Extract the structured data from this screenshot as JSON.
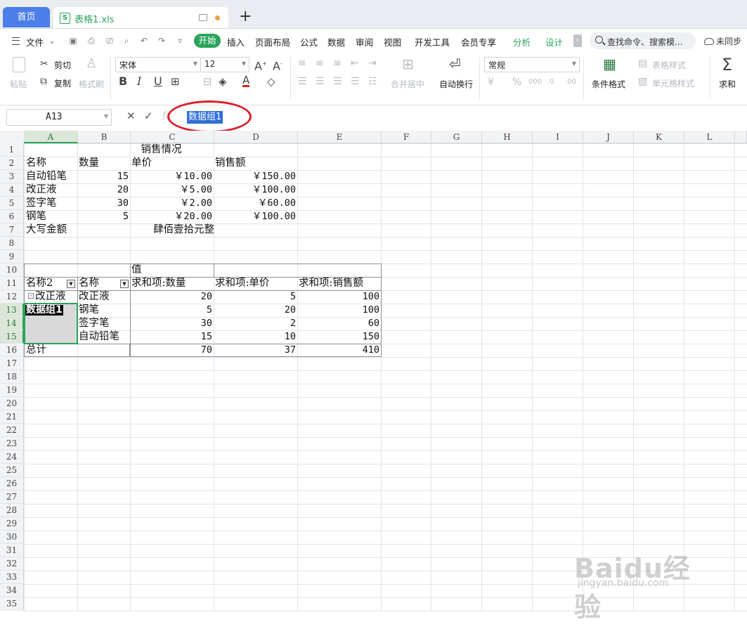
{
  "tabs": {
    "home": "首页",
    "file": "表格1.xls",
    "add": "+"
  },
  "menu": {
    "file": "文件",
    "items": [
      "开始",
      "插入",
      "页面布局",
      "公式",
      "数据",
      "审阅",
      "视图",
      "开发工具",
      "会员专享",
      "分析",
      "设计"
    ],
    "search_placeholder": "查找命令、搜索模...",
    "sync": "未同步"
  },
  "ribbon": {
    "paste": "粘贴",
    "cut": "剪切",
    "copy": "复制",
    "format_painter": "格式刷",
    "font_name": "宋体",
    "font_size": "12",
    "merge_center": "合并居中",
    "wrap_text": "自动换行",
    "number_format": "常规",
    "conditional_format": "条件格式",
    "table_style": "表格样式",
    "cell_style": "单元格样式",
    "sum": "求和",
    "bold": "B",
    "italic": "I",
    "underline": "U",
    "font_color": "A"
  },
  "formula_bar": {
    "name_box": "A13",
    "formula": "数据组1"
  },
  "columns": [
    "A",
    "B",
    "C",
    "D",
    "E",
    "F",
    "G",
    "H",
    "I",
    "J",
    "K",
    "L"
  ],
  "selected_column": "A",
  "rows": [
    "1",
    "2",
    "3",
    "4",
    "5",
    "6",
    "7",
    "8",
    "9",
    "10",
    "11",
    "12",
    "13",
    "14",
    "15",
    "16",
    "17",
    "18",
    "19",
    "20",
    "21",
    "22",
    "23",
    "24",
    "25",
    "26",
    "27",
    "28",
    "29",
    "30",
    "31",
    "32",
    "33",
    "34",
    "35"
  ],
  "selected_rows": [
    "13",
    "14",
    "15"
  ],
  "sheet": {
    "title": "销售情况",
    "headers": [
      "名称",
      "数量",
      "单价",
      "销售额"
    ],
    "data": [
      [
        "自动铅笔",
        "15",
        "￥10.00",
        "￥150.00"
      ],
      [
        "改正液",
        "20",
        "￥5.00",
        "￥100.00"
      ],
      [
        "签字笔",
        "30",
        "￥2.00",
        "￥60.00"
      ],
      [
        "钢笔",
        "5",
        "￥20.00",
        "￥100.00"
      ]
    ],
    "total_label": "大写金额",
    "total_value": "肆佰壹拾元整"
  },
  "pivot": {
    "values_label": "值",
    "headers": [
      "名称2",
      "名称",
      "求和项:数量",
      "求和项:单价",
      "求和项:销售额"
    ],
    "rows": [
      [
        "改正液",
        "改正液",
        "20",
        "5",
        "100"
      ],
      [
        "数据组1",
        "钢笔",
        "5",
        "20",
        "100"
      ],
      [
        "",
        "签字笔",
        "30",
        "2",
        "60"
      ],
      [
        "",
        "自动铅笔",
        "15",
        "10",
        "150"
      ]
    ],
    "total": [
      "总计",
      "",
      "70",
      "37",
      "410"
    ]
  },
  "watermark": {
    "brand": "Baidu经验",
    "url": "jingyan.baidu.com"
  }
}
